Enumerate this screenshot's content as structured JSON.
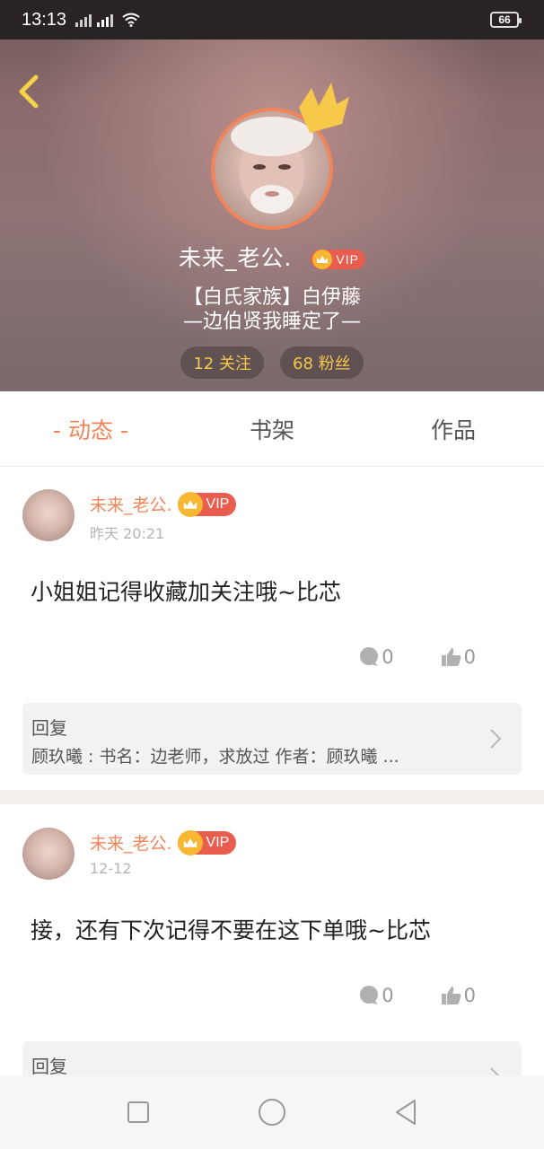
{
  "status_bar": {
    "time": "13:13",
    "battery": "66"
  },
  "profile": {
    "username": "未来_老公.",
    "vip_label": "VIP",
    "bio_line1": "【白氏家族】白伊藤",
    "bio_line2": "—边伯贤我睡定了—",
    "following": "12 关注",
    "followers": "68 粉丝"
  },
  "tabs": [
    {
      "label": "- 动态 -",
      "active": true
    },
    {
      "label": "书架",
      "active": false
    },
    {
      "label": "作品",
      "active": false
    }
  ],
  "posts": [
    {
      "author": "未来_老公.",
      "vip_label": "VIP",
      "time": "昨天 20:21",
      "content": "小姐姐记得收藏加关注哦~比芯",
      "comments": "0",
      "likes": "0",
      "reply_title": "回复",
      "reply_text": "顾玖曦 : 书名：边老师，求放过 作者：顾玖曦 ..."
    },
    {
      "author": "未来_老公.",
      "vip_label": "VIP",
      "time": "12-12",
      "content": "接，还有下次记得不要在这下单哦~比芯",
      "comments": "0",
      "likes": "0",
      "reply_title": "回复"
    }
  ],
  "colors": {
    "accent": "#f0855a",
    "vip_red": "#e85d4e",
    "gold": "#f6c84a"
  }
}
